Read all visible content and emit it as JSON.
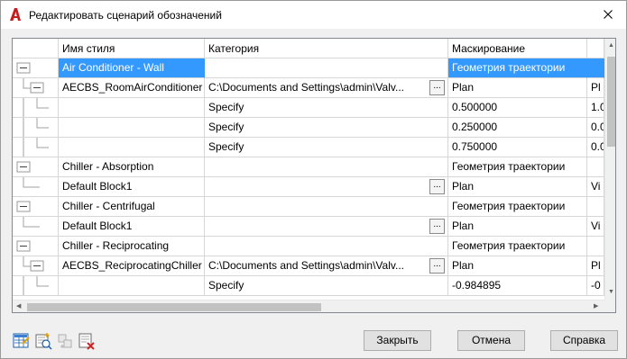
{
  "window": {
    "title": "Редактировать сценарий обозначений",
    "close_icon": "close-icon",
    "accent": "#c41e1e"
  },
  "grid": {
    "headers": {
      "name": "Имя стиля",
      "category": "Категория",
      "masking": "Маскирование"
    },
    "selection_color": "#3399ff",
    "rows": [
      {
        "name": "Air Conditioner - Wall",
        "category": "",
        "masking": "Геометрия траектории",
        "extra": ""
      },
      {
        "name": "AECBS_RoomAirConditioner",
        "category": "C:\\Documents and Settings\\admin\\Valv...",
        "masking": "Plan",
        "extra": "Pl"
      },
      {
        "name": "",
        "category": "Specify",
        "masking": "0.500000",
        "extra": "1.0"
      },
      {
        "name": "",
        "category": "Specify",
        "masking": "0.250000",
        "extra": "0.0"
      },
      {
        "name": "",
        "category": "Specify",
        "masking": "0.750000",
        "extra": "0.0"
      },
      {
        "name": "Chiller - Absorption",
        "category": "",
        "masking": "Геометрия траектории",
        "extra": ""
      },
      {
        "name": "Default Block1",
        "category": "",
        "masking": "Plan",
        "extra": "Vi"
      },
      {
        "name": "Chiller - Centrifugal",
        "category": "",
        "masking": "Геометрия траектории",
        "extra": ""
      },
      {
        "name": "Default Block1",
        "category": "",
        "masking": "Plan",
        "extra": "Vi"
      },
      {
        "name": "Chiller - Reciprocating",
        "category": "",
        "masking": "Геометрия траектории",
        "extra": ""
      },
      {
        "name": "AECBS_ReciprocatingChiller",
        "category": "C:\\Documents and Settings\\admin\\Valv...",
        "masking": "Plan",
        "extra": "Pl"
      },
      {
        "name": "",
        "category": "Specify",
        "masking": "-0.984895",
        "extra": "-0"
      }
    ],
    "ellipsis_label": "..."
  },
  "toolbar": {
    "icons": [
      "edit-grid-icon",
      "add-item-icon",
      "move-item-icon",
      "delete-item-icon"
    ]
  },
  "buttons": {
    "close": "Закрыть",
    "cancel": "Отмена",
    "help": "Справка"
  }
}
